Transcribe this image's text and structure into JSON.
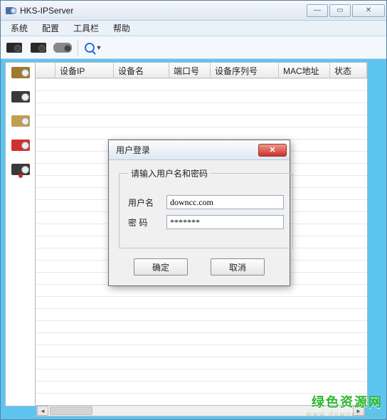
{
  "window": {
    "title": "HKS-IPServer"
  },
  "menu": {
    "system": "系统",
    "config": "配置",
    "toolbar": "工具栏",
    "help": "帮助"
  },
  "columns": {
    "device_ip": "设备IP",
    "device_name": "设备名",
    "port": "端口号",
    "serial": "设备序列号",
    "mac": "MAC地址",
    "status": "状态"
  },
  "login": {
    "title": "用户登录",
    "legend": "请输入用户名和密码",
    "user_label": "用户名",
    "pass_label": "密  码",
    "user_value": "downcc.com",
    "pass_value": "*******",
    "ok": "确定",
    "cancel": "取消"
  },
  "watermark": {
    "zh": "绿色资源网",
    "en": "www.downcc.com"
  }
}
